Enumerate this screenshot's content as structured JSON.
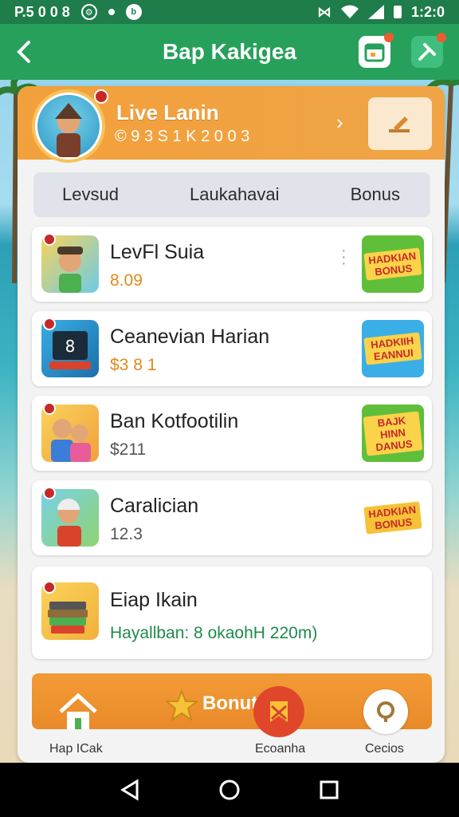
{
  "status_bar": {
    "left_text": "P.5 0 0 8",
    "time": "1:2:0"
  },
  "app_bar": {
    "title": "Bap Kakigea"
  },
  "profile": {
    "name": "Live Lanin",
    "id": "© 9 3 S 1 K 2 0 0 3"
  },
  "tabs": [
    {
      "label": "Levsud"
    },
    {
      "label": "Laukahavai"
    },
    {
      "label": "Bonus"
    }
  ],
  "items": [
    {
      "title": "LevFl Suia",
      "subtitle": "8.09",
      "subtitle_color": "#e08a1a",
      "bonus": "HADKIAN BONUS",
      "bonus_bg": "#5fbf3a"
    },
    {
      "title": "Ceanevian Harian",
      "subtitle": "$3 8 1",
      "subtitle_color": "#e08a1a",
      "bonus": "HADKIIH EANNUI",
      "bonus_bg": "#3aaee6"
    },
    {
      "title": "Ban Kotfootilin",
      "subtitle": "$211",
      "subtitle_color": "#555555",
      "bonus": "BAJK HINN DANUS",
      "bonus_bg": "#5fbf3a"
    },
    {
      "title": "Caralician",
      "subtitle": "12.3",
      "subtitle_color": "#555555",
      "bonus": "HADKIAN BONUS",
      "bonus_bg": "#ffffff"
    },
    {
      "title": "Eiap Ikain",
      "subtitle": "Hayallban: 8 okaohH 220m)",
      "subtitle_color": "#1f8a4c"
    }
  ],
  "bottom_nav": {
    "bonus_label": "Bonut",
    "home_label": "Hap ICak",
    "center_label": "Ecoanha",
    "right_label": "Cecios"
  },
  "colors": {
    "status_bar": "#1e7d4a",
    "app_bar": "#27a05c",
    "orange": "#f2a03b"
  }
}
